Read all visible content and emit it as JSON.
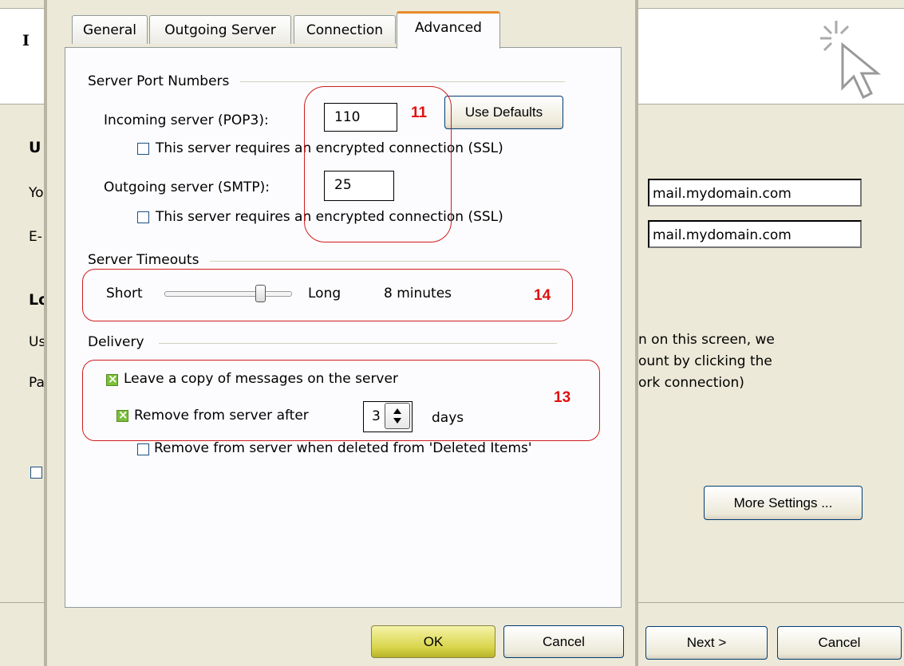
{
  "background": {
    "header_letter": "I",
    "section1_heading": "U",
    "row1_label": "Yo",
    "row2_label": "E-",
    "section2_heading": "Lo",
    "row3_label": "Us",
    "row4_label": "Pa",
    "incoming_field_value": "mail.mydomain.com",
    "outgoing_field_value": "mail.mydomain.com",
    "info_line1": "n on this screen, we",
    "info_line2": "ount by clicking the",
    "info_line3": "ork connection)",
    "more_settings_label": "More Settings ...",
    "next_label": "Next >",
    "cancel_label": "Cancel"
  },
  "dialog": {
    "tabs": [
      {
        "label": "General"
      },
      {
        "label": "Outgoing Server"
      },
      {
        "label": "Connection"
      },
      {
        "label": "Advanced"
      }
    ],
    "server_ports": {
      "title": "Server Port Numbers",
      "incoming_label": "Incoming server (POP3):",
      "incoming_value": "110",
      "use_defaults_label": "Use Defaults",
      "incoming_ssl_label": "This server requires an encrypted connection (SSL)",
      "outgoing_label": "Outgoing server (SMTP):",
      "outgoing_value": "25",
      "outgoing_ssl_label": "This server requires an encrypted connection (SSL)"
    },
    "timeouts": {
      "title": "Server Timeouts",
      "short_label": "Short",
      "long_label": "Long",
      "value_label": "8 minutes",
      "slider_level": 0.75
    },
    "delivery": {
      "title": "Delivery",
      "leave_copy_label": "Leave a copy of messages on the server",
      "leave_copy_checked": true,
      "remove_after_label": "Remove from server after",
      "remove_after_checked": true,
      "remove_after_days": "3",
      "days_label": "days",
      "remove_deleted_label": "Remove from server when deleted from 'Deleted Items'",
      "remove_deleted_checked": false
    },
    "ok_label": "OK",
    "cancel_label": "Cancel"
  },
  "annotations": {
    "ports": "11",
    "timeouts": "14",
    "delivery": "13",
    "color": "#e01010"
  }
}
